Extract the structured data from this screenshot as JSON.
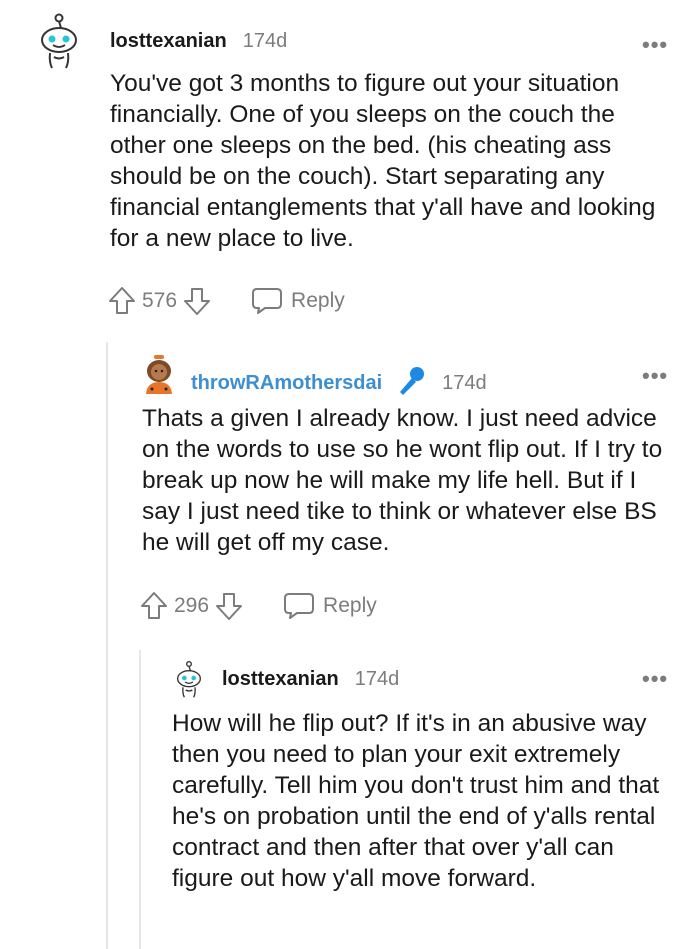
{
  "comments": [
    {
      "username": "losttexanian",
      "age": "174d",
      "body": "You've got 3 months to figure out your situation financially. One of you sleeps on the couch the other one sleeps on the bed. (his cheating ass should be on the couch). Start separating any financial entanglements that y'all have and looking for a new place to live.",
      "score": "576",
      "reply_label": "Reply",
      "more_label": "•••"
    },
    {
      "username": "throwRAmothersdai",
      "age": "174d",
      "body": "Thats a given I already know. I just need advice on the words to use so he wont flip out. If I try to break up now he will make my life hell. But if I say I just need tike to think or whatever else BS he will get off my case.",
      "score": "296",
      "reply_label": "Reply",
      "more_label": "•••"
    },
    {
      "username": "losttexanian",
      "age": "174d",
      "body": "How will he flip out? If it's in an abusive way then you need to plan your exit extremely carefully. Tell him you don't trust him and that he's on probation until the end of y'alls rental contract and then after that over y'all can figure out how y'all move forward.",
      "more_label": "•••"
    }
  ],
  "colors": {
    "op_username": "#3d8fd1",
    "meta_gray": "#7c7c7c",
    "mic_blue": "#1e88e5",
    "thread_line": "#e6e6e6"
  }
}
